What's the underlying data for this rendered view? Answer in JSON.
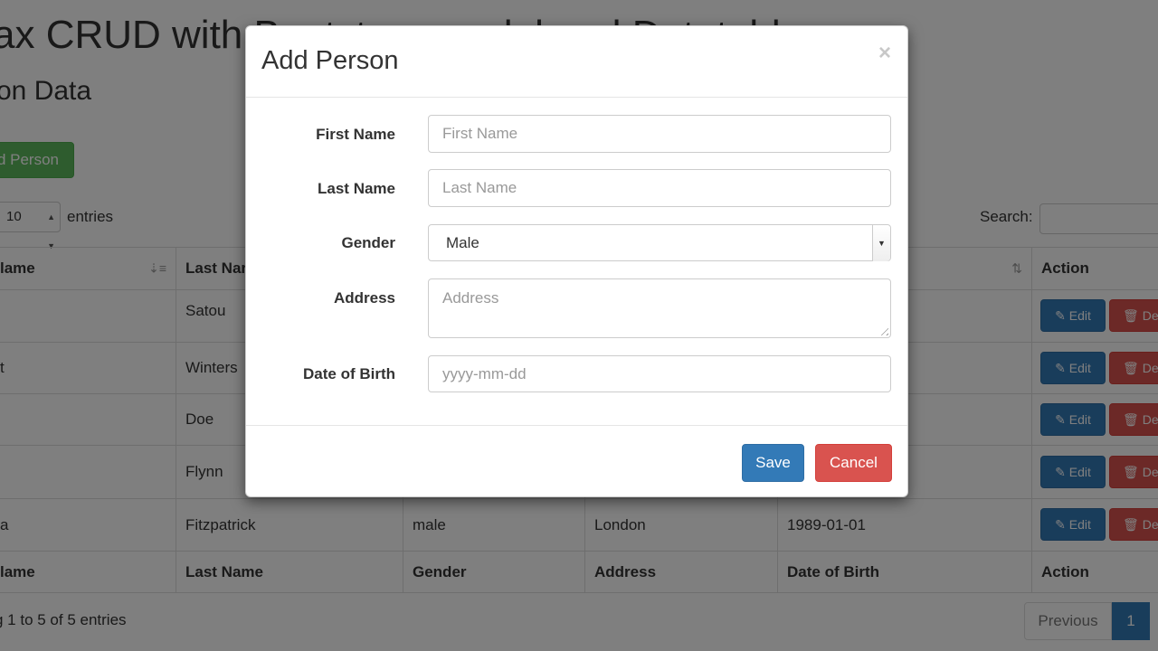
{
  "page": {
    "title": "ax CRUD with Bootstrap modal and Datatable",
    "subtitle": "on Data",
    "add_button": "d Person",
    "length_value": "10",
    "entries_label": "entries",
    "search_label": "Search:",
    "info": "g 1 to 5 of 5 entries",
    "pager_previous": "Previous",
    "pager_current": "1"
  },
  "table": {
    "headers": [
      "lame",
      "Last Nar",
      "",
      "",
      "",
      "Action"
    ],
    "footers": [
      "lame",
      "Last Name",
      "Gender",
      "Address",
      "Date of Birth",
      "Action"
    ],
    "rows": [
      [
        "",
        "Satou",
        "",
        "",
        ""
      ],
      [
        "t",
        "Winters",
        "",
        "",
        ""
      ],
      [
        "",
        "Doe",
        "",
        "",
        ""
      ],
      [
        "",
        "Flynn",
        "",
        "",
        ""
      ],
      [
        "a",
        "Fitzpatrick",
        "male",
        "London",
        "1989-01-01"
      ]
    ],
    "edit_label": "Edit",
    "delete_label": "Dele"
  },
  "modal": {
    "title": "Add Person",
    "close_symbol": "×",
    "fields": {
      "first_name": {
        "label": "First Name",
        "placeholder": "First Name"
      },
      "last_name": {
        "label": "Last Name",
        "placeholder": "Last Name"
      },
      "gender": {
        "label": "Gender",
        "value": "Male"
      },
      "address": {
        "label": "Address",
        "placeholder": "Address"
      },
      "dob": {
        "label": "Date of Birth",
        "placeholder": "yyyy-mm-dd"
      }
    },
    "save_label": "Save",
    "cancel_label": "Cancel"
  },
  "colors": {
    "primary": "#337ab7",
    "danger": "#d9534f",
    "success": "#5cb85c",
    "backdrop": "rgba(0,0,0,0.5)"
  },
  "icons": {
    "edit": "pencil-icon",
    "delete": "trash-icon",
    "sort": "sort-icon",
    "close": "close-icon"
  }
}
